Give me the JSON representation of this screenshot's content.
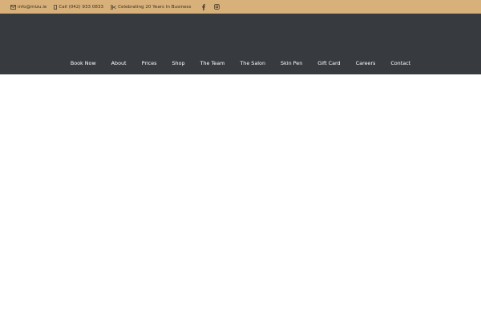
{
  "topbar": {
    "background": "#d7b07a",
    "email": {
      "icon": "envelope-icon",
      "text": "info@mizu.ie"
    },
    "phone": {
      "icon": "mobile-phone-icon",
      "text": "Call (042) 933 0833"
    },
    "tagline": {
      "icon": "scissors-icon",
      "text": "Celebrating 20 Years In Business"
    },
    "social": [
      {
        "icon": "facebook-icon"
      },
      {
        "icon": "instagram-icon"
      }
    ]
  },
  "header": {
    "background": "#373b3f",
    "nav": [
      {
        "label": "Book Now"
      },
      {
        "label": "About"
      },
      {
        "label": "Prices"
      },
      {
        "label": "Shop"
      },
      {
        "label": "The Team"
      },
      {
        "label": "The Salon"
      },
      {
        "label": "Skin Pen"
      },
      {
        "label": "Gift Card"
      },
      {
        "label": "Careers"
      },
      {
        "label": "Contact"
      }
    ]
  }
}
